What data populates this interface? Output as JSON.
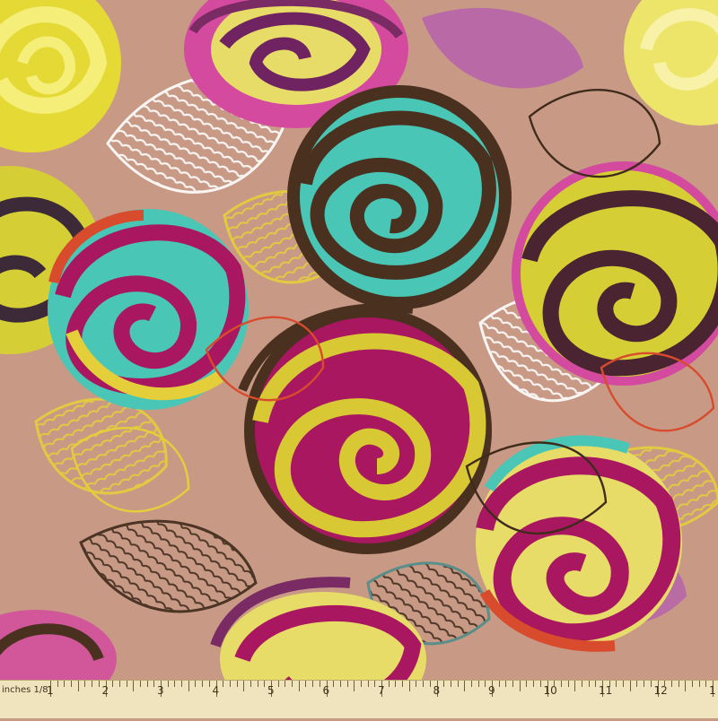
{
  "ruler": {
    "unit_label": "inches 1/8",
    "labels": [
      "1",
      "2",
      "3",
      "4",
      "5",
      "6",
      "7",
      "8",
      "9",
      "10",
      "11",
      "12",
      "1"
    ]
  },
  "colors": {
    "background": "#c89a86",
    "brown": "#4a311f",
    "teal": "#49c6b5",
    "magenta": "#a8175f",
    "yellow": "#d7c935",
    "pink": "#d34a9e",
    "purple": "#7a2b64",
    "orange": "#d84b2c",
    "cream": "#f4e4a3"
  }
}
